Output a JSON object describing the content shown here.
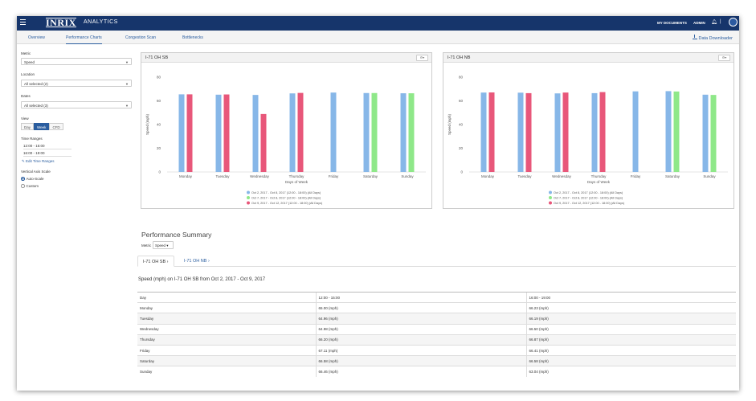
{
  "topbar": {
    "logo": "INRIX",
    "logo_sub": "ANALYTICS",
    "my_documents": "MY DOCUMENTS",
    "admin": "ADMIN",
    "divider": "|"
  },
  "nav": {
    "tabs": [
      "Overview",
      "Performance Charts",
      "Congestion Scan",
      "Bottlenecks"
    ],
    "active_index": 1,
    "downloader": "Data Downloader"
  },
  "sidebar": {
    "metric_label": "Metric",
    "metric_value": "Speed",
    "location_label": "Location",
    "location_value": "All selected (2)",
    "dates_label": "Dates",
    "dates_value": "All selected (3)",
    "view_label": "View",
    "view_options": [
      "Day",
      "Week",
      "CFD"
    ],
    "view_active": "Week",
    "time_ranges_label": "Time Ranges",
    "time_ranges": [
      "12:00 - 15:00",
      "16:00 - 19:00"
    ],
    "edit_time_ranges": "Edit Time Ranges",
    "axis_scale_label": "Vertical Axis Scale",
    "axis_scale_options": [
      "Auto-Scale",
      "Custom"
    ],
    "axis_scale_selected": "Auto-Scale"
  },
  "colors": {
    "series_blue": "#87b7e8",
    "series_green": "#8fe889",
    "series_pink": "#e8577a",
    "brand": "#16356b",
    "accent": "#2a5d9f"
  },
  "chart_data": [
    {
      "type": "bar",
      "title": "I-71 OH SB",
      "xlabel": "Days of Week",
      "ylabel": "Speed (mph)",
      "ylim": [
        0,
        80
      ],
      "yticks": [
        0,
        20,
        40,
        60,
        80
      ],
      "categories": [
        "Monday",
        "Tuesday",
        "Wednesday",
        "Thursday",
        "Friday",
        "Saturday",
        "Sunday"
      ],
      "series": [
        {
          "name": "Oct 2, 2017 - Oct 8, 2017 (12:00 - 18:00) (All Days)",
          "color": "#87b7e8",
          "values": [
            65.5,
            65.2,
            65.0,
            66.3,
            67.0,
            66.6,
            66.4
          ]
        },
        {
          "name": "Oct 7, 2017 - Oct 8, 2017 (12:00 - 18:00) (All Days)",
          "color": "#8fe889",
          "values": [
            null,
            null,
            null,
            null,
            null,
            66.6,
            66.4
          ]
        },
        {
          "name": "Oct 9, 2017 - Oct 12, 2017 (12:00 - 18:00) (All Days)",
          "color": "#e8577a",
          "values": [
            65.5,
            65.4,
            48.9,
            66.7,
            null,
            null,
            null
          ]
        }
      ],
      "legend_placement": "bottom",
      "grid": false
    },
    {
      "type": "bar",
      "title": "I-71 OH NB",
      "xlabel": "Days of Week",
      "ylabel": "Speed (mph)",
      "ylim": [
        0,
        80
      ],
      "yticks": [
        0,
        20,
        40,
        60,
        80
      ],
      "categories": [
        "Monday",
        "Tuesday",
        "Wednesday",
        "Thursday",
        "Friday",
        "Saturday",
        "Sunday"
      ],
      "series": [
        {
          "name": "Oct 2, 2017 - Oct 8, 2017 (12:00 - 18:00) (All Days)",
          "color": "#87b7e8",
          "values": [
            67.0,
            66.9,
            66.3,
            66.5,
            68.0,
            68.2,
            65.2
          ]
        },
        {
          "name": "Oct 7, 2017 - Oct 8, 2017 (12:00 - 18:00) (All Days)",
          "color": "#8fe889",
          "values": [
            null,
            null,
            null,
            null,
            null,
            67.9,
            65.0
          ]
        },
        {
          "name": "Oct 9, 2017 - Oct 12, 2017 (12:00 - 18:00) (All Days)",
          "color": "#e8577a",
          "values": [
            67.1,
            66.5,
            67.0,
            67.4,
            null,
            null,
            null
          ]
        }
      ],
      "legend_placement": "bottom",
      "grid": false
    }
  ],
  "summary": {
    "title": "Performance Summary",
    "metric_label": "Metric",
    "metric_value": "Speed",
    "tabs": [
      "I-71 OH SB",
      "I-71 OH NB"
    ],
    "active_tab": 0,
    "heading": "Speed (mph) on I-71 OH SB from Oct 2, 2017 - Oct 9, 2017",
    "columns": [
      "Day",
      "12:00 - 15:00",
      "16:00 - 19:00"
    ],
    "rows": [
      [
        "Monday",
        "65.00 (mph)",
        "66.23 (mph)"
      ],
      [
        "Tuesday",
        "64.96 (mph)",
        "66.19 (mph)"
      ],
      [
        "Wednesday",
        "64.98 (mph)",
        "66.50 (mph)"
      ],
      [
        "Thursday",
        "66.20 (mph)",
        "66.87 (mph)"
      ],
      [
        "Friday",
        "67.11 (mph)",
        "66.41 (mph)"
      ],
      [
        "Saturday",
        "66.58 (mph)",
        "66.58 (mph)"
      ],
      [
        "Sunday",
        "66.46 (mph)",
        "63.04 (mph)"
      ]
    ]
  }
}
